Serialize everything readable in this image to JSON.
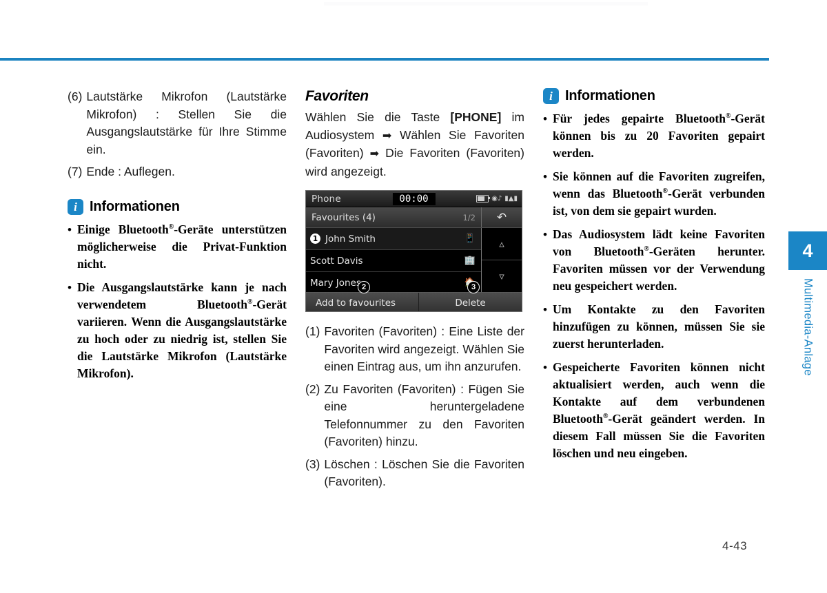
{
  "page": {
    "number": "4-43",
    "accent_color": "#1b86c6",
    "rule_color": "#1b83c0"
  },
  "side_tab": {
    "chapter_number": "4",
    "chapter_label": "Multimedia-Anlage"
  },
  "column_left": {
    "numbered_items": [
      {
        "num": "(6)",
        "text": "Lautstärke Mikrofon (Lautstärke Mikrofon) : Stellen Sie die Ausgangslautstärke für Ihre Stimme ein."
      },
      {
        "num": "(7)",
        "text": "Ende : Auflegen."
      }
    ],
    "info_box": {
      "icon": "info-icon",
      "icon_glyph": "i",
      "title": "Informationen",
      "bullets": [
        "Einige Bluetooth®-Geräte unterstützen möglicherweise die Privat-Funktion nicht.",
        "Die Ausgangslautstärke kann je nach verwendetem Bluetooth®-Gerät variieren. Wenn die Ausgangslautstärke zu hoch oder zu niedrig ist, stellen Sie die Lautstärke Mikrofon (Lautstärke Mikrofon)."
      ]
    }
  },
  "column_middle": {
    "section_title": "Favoriten",
    "intro_parts": {
      "p1": "Wählen Sie die Taste ",
      "bold1": "[PHONE]",
      "p2": " im Audiosystem ",
      "arrow1": "➡",
      "p3": " Wählen Sie Favoriten (Favoriten) ",
      "arrow2": "➡",
      "p4": " Die Favoriten (Favoriten) wird angezeigt."
    },
    "device": {
      "title": "Phone",
      "clock": "00:00",
      "status_icons": [
        "battery-icon",
        "bluetooth-audio-icon",
        "signal-icon"
      ],
      "subheader_title": "Favourites (4)",
      "page_indicator": "1/2",
      "back_icon": "↰",
      "rows": [
        {
          "callout": "1",
          "name": "John Smith",
          "icon": "mobile-phone-icon",
          "selected": true
        },
        {
          "callout": "",
          "name": "Scott Davis",
          "icon": "office-building-icon",
          "selected": false
        },
        {
          "callout": "",
          "name": "Mary Jones",
          "icon": "home-icon",
          "selected": false
        }
      ],
      "scroll_up_icon": "⌃",
      "scroll_down_icon": "⌄",
      "buttons": [
        {
          "label": "Add to favourites",
          "callout": "2"
        },
        {
          "label": "Delete",
          "callout": "3"
        }
      ]
    },
    "numbered_items": [
      {
        "num": "(1)",
        "text": "Favoriten (Favoriten) : Eine Liste der Favoriten wird angezeigt. Wählen Sie einen Eintrag aus, um ihn anzurufen."
      },
      {
        "num": "(2)",
        "text": "Zu Favoriten (Favoriten) : Fügen Sie eine heruntergeladene Telefonnummer zu den Favoriten (Favoriten) hinzu."
      },
      {
        "num": "(3)",
        "text": "Löschen : Löschen Sie die Favoriten (Favoriten)."
      }
    ]
  },
  "column_right": {
    "info_box": {
      "icon": "info-icon",
      "icon_glyph": "i",
      "title": "Informationen",
      "bullets": [
        "Für jedes gepairte Bluetooth®-Gerät können bis zu 20 Favoriten gepairt werden.",
        "Sie können auf die Favoriten zugreifen, wenn das Bluetooth®-Gerät verbunden ist, von dem sie gepairt wurden.",
        "Das Audiosystem lädt keine Favoriten von Bluetooth®-Geräten herunter. Favoriten müssen vor der Verwendung neu gespeichert werden.",
        "Um Kontakte zu den Favoriten hinzufügen zu können, müssen Sie sie zuerst herunterladen.",
        "Gespeicherte Favoriten können nicht aktualisiert werden, auch wenn die Kontakte auf dem verbundenen Bluetooth®-Gerät geändert werden. In diesem Fall müssen Sie die Favoriten löschen und neu eingeben."
      ]
    }
  }
}
